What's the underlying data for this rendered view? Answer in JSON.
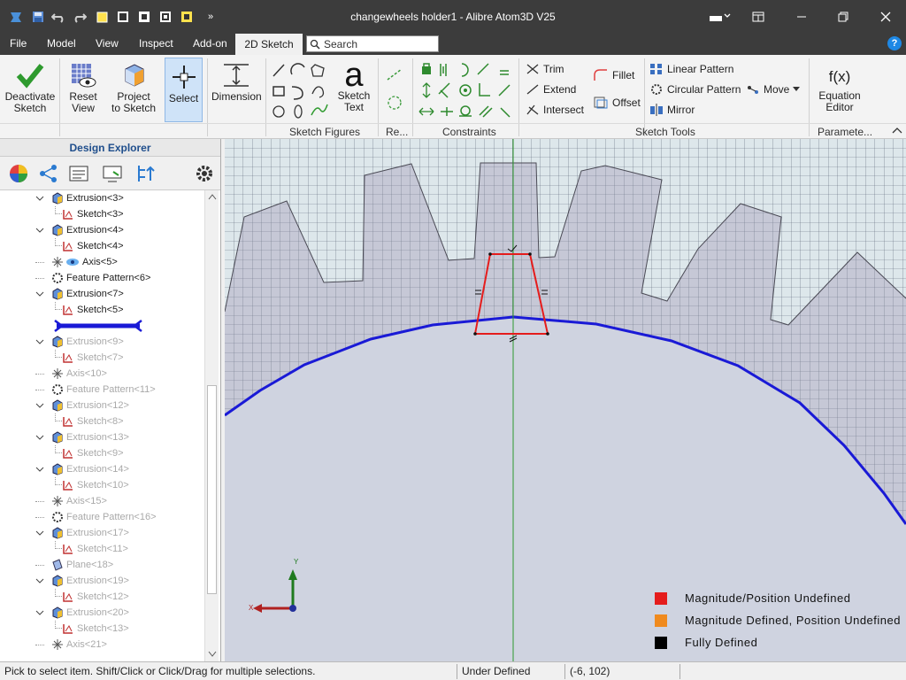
{
  "window": {
    "title": "changewheels holder1 - Alibre Atom3D V25"
  },
  "menu": {
    "items": [
      "File",
      "Model",
      "View",
      "Inspect",
      "Add-on"
    ],
    "active_tab": "2D Sketch",
    "search_placeholder": "Search"
  },
  "ribbon": {
    "deactivate": [
      "Deactivate",
      "Sketch"
    ],
    "reset_view": [
      "Reset",
      "View"
    ],
    "project": [
      "Project",
      "to Sketch"
    ],
    "select": "Select",
    "dimension": "Dimension",
    "sketch_text": [
      "Sketch",
      "Text"
    ],
    "trim": "Trim",
    "extend": "Extend",
    "intersect": "Intersect",
    "fillet": "Fillet",
    "offset": "Offset",
    "linear_pattern": "Linear Pattern",
    "circular_pattern": "Circular Pattern",
    "mirror": "Mirror",
    "move": "Move",
    "equation": [
      "Equation",
      "Editor"
    ],
    "groups": {
      "sketch_figures": "Sketch Figures",
      "reference": "Re...",
      "constraints": "Constraints",
      "sketch_tools": "Sketch Tools",
      "parameters": "Paramete..."
    }
  },
  "explorer": {
    "title": "Design Explorer",
    "tree": [
      {
        "label": "Extrusion<3>",
        "type": "extrusion",
        "level": 0,
        "dim": false
      },
      {
        "label": "Sketch<3>",
        "type": "sketch",
        "level": 1,
        "dim": false
      },
      {
        "label": "Extrusion<4>",
        "type": "extrusion",
        "level": 0,
        "dim": false
      },
      {
        "label": "Sketch<4>",
        "type": "sketch",
        "level": 1,
        "dim": false
      },
      {
        "label": "Axis<5>",
        "type": "axis",
        "level": 0,
        "dim": false
      },
      {
        "label": "Feature Pattern<6>",
        "type": "pattern",
        "level": 0,
        "dim": false
      },
      {
        "label": "Extrusion<7>",
        "type": "extrusion",
        "level": 0,
        "dim": false
      },
      {
        "label": "Sketch<5>",
        "type": "sketch",
        "level": 1,
        "dim": false
      },
      {
        "label": "",
        "type": "rollback",
        "level": 0,
        "dim": false
      },
      {
        "label": "Extrusion<9>",
        "type": "extrusion",
        "level": 0,
        "dim": true
      },
      {
        "label": "Sketch<7>",
        "type": "sketch",
        "level": 1,
        "dim": true
      },
      {
        "label": "Axis<10>",
        "type": "axis",
        "level": 0,
        "dim": true
      },
      {
        "label": "Feature Pattern<11>",
        "type": "pattern",
        "level": 0,
        "dim": true
      },
      {
        "label": "Extrusion<12>",
        "type": "extrusion",
        "level": 0,
        "dim": true
      },
      {
        "label": "Sketch<8>",
        "type": "sketch",
        "level": 1,
        "dim": true
      },
      {
        "label": "Extrusion<13>",
        "type": "extrusion",
        "level": 0,
        "dim": true
      },
      {
        "label": "Sketch<9>",
        "type": "sketch",
        "level": 1,
        "dim": true
      },
      {
        "label": "Extrusion<14>",
        "type": "extrusion",
        "level": 0,
        "dim": true
      },
      {
        "label": "Sketch<10>",
        "type": "sketch",
        "level": 1,
        "dim": true
      },
      {
        "label": "Axis<15>",
        "type": "axis",
        "level": 0,
        "dim": true
      },
      {
        "label": "Feature Pattern<16>",
        "type": "pattern",
        "level": 0,
        "dim": true
      },
      {
        "label": "Extrusion<17>",
        "type": "extrusion",
        "level": 0,
        "dim": true
      },
      {
        "label": "Sketch<11>",
        "type": "sketch",
        "level": 1,
        "dim": true
      },
      {
        "label": "Plane<18>",
        "type": "plane",
        "level": 0,
        "dim": true
      },
      {
        "label": "Extrusion<19>",
        "type": "extrusion",
        "level": 0,
        "dim": true
      },
      {
        "label": "Sketch<12>",
        "type": "sketch",
        "level": 1,
        "dim": true
      },
      {
        "label": "Extrusion<20>",
        "type": "extrusion",
        "level": 0,
        "dim": true
      },
      {
        "label": "Sketch<13>",
        "type": "sketch",
        "level": 1,
        "dim": true
      },
      {
        "label": "Axis<21>",
        "type": "axis",
        "level": 0,
        "dim": true
      }
    ]
  },
  "legend": [
    {
      "label": "Magnitude/Position Undefined",
      "color": "#e51c1c"
    },
    {
      "label": "Magnitude Defined, Position Undefined",
      "color": "#f08a1e"
    },
    {
      "label": "Fully Defined",
      "color": "#000000"
    }
  ],
  "axes_triad": {
    "x": "X",
    "y": "Y"
  },
  "status": {
    "hint": "Pick to select item. Shift/Click or Click/Drag for multiple selections.",
    "state": "Under Defined",
    "coords": "(-6, 102)"
  },
  "colors": {
    "accent": "#0078d7",
    "profile_line": "#1a1ad6",
    "sketch_red": "#e51c1c",
    "axis_green": "#2e9a2e"
  }
}
